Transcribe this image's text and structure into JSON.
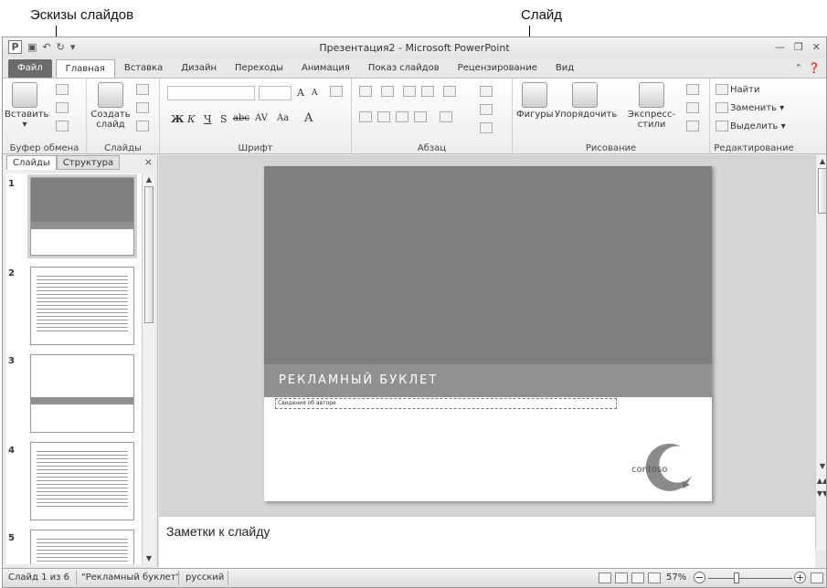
{
  "callouts": {
    "thumbnails": "Эскизы слайдов",
    "slide": "Слайд"
  },
  "window": {
    "title": "Презентация2 - Microsoft PowerPoint",
    "logo_letter": "P"
  },
  "tabs": [
    "Файл",
    "Главная",
    "Вставка",
    "Дизайн",
    "Переходы",
    "Анимация",
    "Показ слайдов",
    "Рецензирование",
    "Вид"
  ],
  "ribbon": {
    "clipboard": {
      "paste": "Вставить",
      "label": "Буфер обмена"
    },
    "slides": {
      "new_slide_1": "Создать",
      "new_slide_2": "слайд",
      "label": "Слайды"
    },
    "font": {
      "label": "Шрифт",
      "bold": "Ж",
      "italic": "К",
      "underline": "Ч",
      "strike": "S",
      "abc": "abc",
      "av": "AV",
      "aa": "Aa",
      "a_big": "A",
      "a_inc": "A",
      "a_dec": "A"
    },
    "paragraph": {
      "label": "Абзац"
    },
    "drawing": {
      "shapes": "Фигуры",
      "arrange": "Упорядочить",
      "quick_styles": "Экспресс-стили",
      "label": "Рисование"
    },
    "editing": {
      "find": "Найти",
      "replace": "Заменить",
      "select": "Выделить",
      "label": "Редактирование"
    }
  },
  "pane": {
    "tab_slides": "Слайды",
    "tab_outline": "Структура",
    "close": "×",
    "thumbnails": [
      {
        "num": "1"
      },
      {
        "num": "2"
      },
      {
        "num": "3"
      },
      {
        "num": "4"
      },
      {
        "num": "5"
      }
    ]
  },
  "slide": {
    "title": "РЕКЛАМНЫЙ БУКЛЕТ",
    "subtitle": "Сведения об авторе",
    "logo_text": "contoso"
  },
  "notes": {
    "placeholder": "Заметки к слайду"
  },
  "status": {
    "slide_count": "Слайд 1 из 6",
    "theme": "\"Рекламный буклет\"",
    "language": "русский",
    "zoom": "57%"
  }
}
